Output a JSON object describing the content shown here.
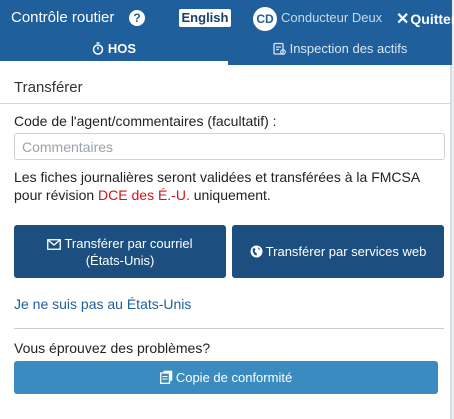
{
  "header": {
    "title": "Contrôle routier",
    "help_icon": "question-circle-icon",
    "language_button": "English",
    "avatar_initials": "CD",
    "driver_name": "Conducteur Deux",
    "quit_glyph": "✕",
    "quit_label": "Quitter"
  },
  "tabs": [
    {
      "label": "HOS",
      "icon": "stopwatch-icon",
      "active": true
    },
    {
      "label": "Inspection des actifs",
      "icon": "inspection-list-icon",
      "active": false
    }
  ],
  "panel": {
    "title": "Transférer",
    "comment_label": "Code de l'agent/commentaires (facultatif) :",
    "comment_placeholder": "Commentaires",
    "comment_value": "",
    "info_text": "Les fiches journalières seront validées et transférées à la FMCSA pour révision ",
    "info_highlight": "DCE des É.-U.",
    "info_suffix": " uniquement."
  },
  "buttons": {
    "email_line1": "Transférer par courriel",
    "email_line2": "(États-Unis)",
    "webservice": "Transférer par services web",
    "not_us_link": "Je ne suis pas au États-Unis",
    "problems_text": "Vous éprouvez des problèmes?",
    "compliance_copy": "Copie de conformité"
  },
  "colors": {
    "header_bg": "#1f5f9c",
    "button_dark": "#1c4f80",
    "button_light": "#3a8bbf",
    "highlight_red": "#d0121b",
    "link": "#1f5f9c"
  }
}
